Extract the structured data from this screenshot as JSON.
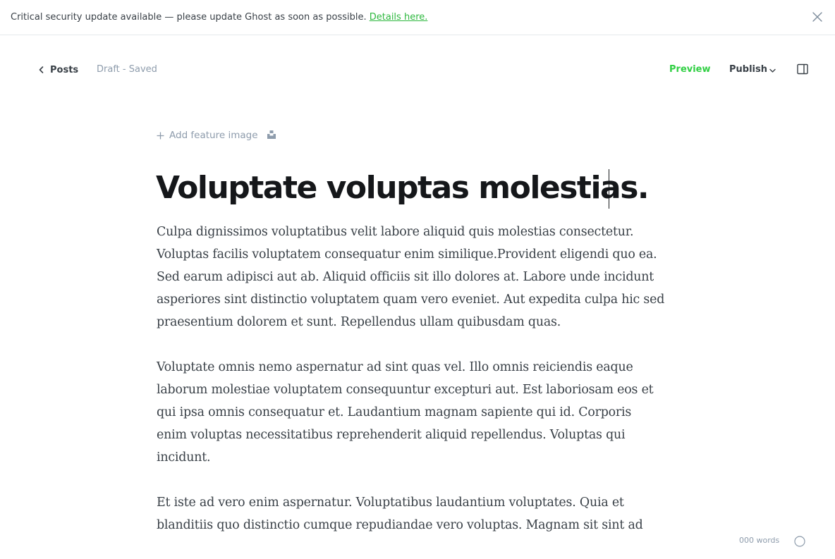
{
  "banner": {
    "message": "Critical security update available — please update Ghost as soon as possible.",
    "link_label": "Details here.",
    "close_icon": "close-icon"
  },
  "header": {
    "back_label": "Posts",
    "status": "Draft - Saved",
    "preview_label": "Preview",
    "publish_label": "Publish",
    "accent_color": "#30cf43"
  },
  "feature": {
    "add_label": "Add feature image",
    "unsplash_icon": "unsplash-icon"
  },
  "post": {
    "title": "Voluptate voluptas molestias.",
    "paragraphs": [
      [
        "Culpa dignissimos voluptatibus velit labore aliquid quis molestias consectetur.",
        "Voluptas facilis voluptatem consequatur enim similique.Provident eligendi quo ea.",
        "Sed earum adipisci aut ab. Aliquid officiis sit illo dolores at. Labore unde incidunt",
        "asperiores sint distinctio voluptatem quam vero eveniet. Aut expedita culpa hic sed",
        "praesentium dolorem et sunt. Repellendus ullam quibusdam quas."
      ],
      [
        "Voluptate omnis nemo aspernatur ad sint quas vel. Illo omnis reiciendis eaque",
        "laborum molestiae voluptatem consequuntur excepturi aut. Est laboriosam eos et",
        "qui ipsa omnis consequatur et. Laudantium magnam sapiente qui id. Corporis",
        "enim voluptas necessitatibus reprehenderit aliquid repellendus. Voluptas qui",
        "incidunt."
      ],
      [
        "Et iste ad vero enim aspernatur. Voluptatibus laudantium voluptates. Quia et",
        "blanditiis quo distinctio cumque repudiandae vero voluptas. Magnam sit sint ad"
      ]
    ]
  },
  "footer": {
    "word_count": "000 words"
  }
}
